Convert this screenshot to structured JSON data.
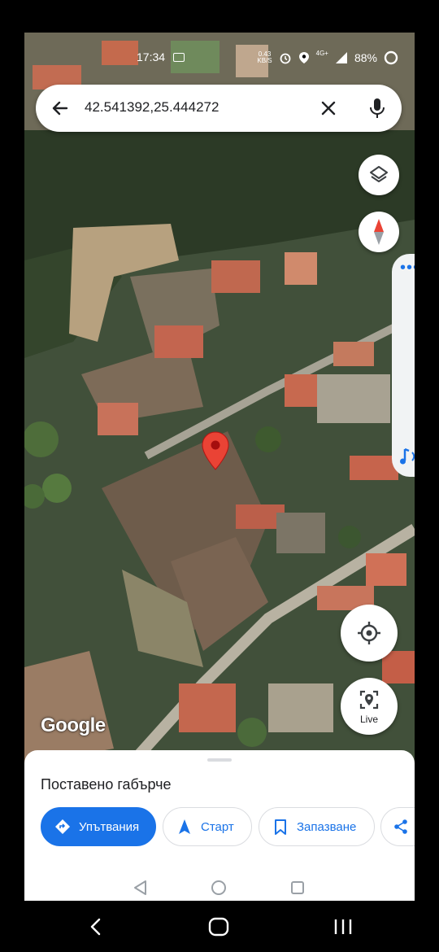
{
  "status": {
    "time": "17:34",
    "net_speed_value": "0.43",
    "net_speed_unit": "KB/S",
    "network": "4G+",
    "battery": "88%"
  },
  "search": {
    "query": "42.541392,25.444272"
  },
  "map": {
    "logo": "Google",
    "pin_color": "#ea4335"
  },
  "live_button": {
    "label": "Live"
  },
  "sheet": {
    "title": "Поставено габърче",
    "actions": [
      {
        "label": "Упътвания"
      },
      {
        "label": "Старт"
      },
      {
        "label": "Запазване"
      }
    ]
  },
  "colors": {
    "accent": "#1a73e8",
    "compass_red": "#ea4335"
  }
}
